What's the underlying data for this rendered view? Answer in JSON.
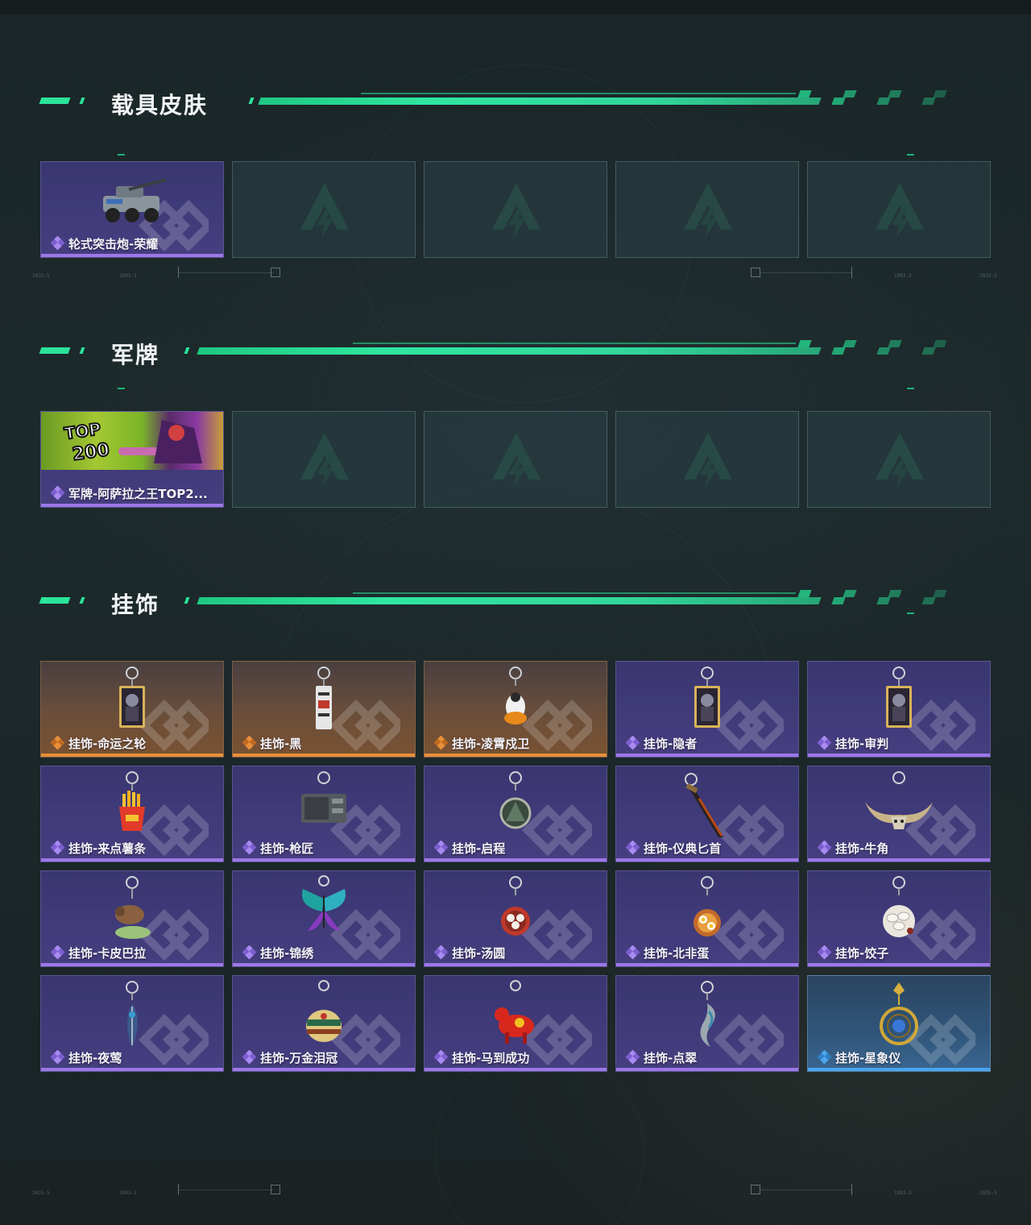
{
  "colors": {
    "accent": "#2be39a",
    "rarity_purple": "#9c78e8",
    "rarity_gold": "#e88f3a",
    "rarity_blue": "#4aa6ee"
  },
  "sections": [
    {
      "title": "载具皮肤",
      "items": [
        {
          "name": "轮式突击炮-荣耀",
          "rarity": "purple",
          "icon": "armored-vehicle-icon"
        },
        {
          "empty": true
        },
        {
          "empty": true
        },
        {
          "empty": true
        },
        {
          "empty": true
        }
      ]
    },
    {
      "title": "军牌",
      "items": [
        {
          "name": "军牌-阿萨拉之王TOP2...",
          "rarity": "purple",
          "icon": "top200-banner-icon"
        },
        {
          "empty": true
        },
        {
          "empty": true
        },
        {
          "empty": true
        },
        {
          "empty": true
        }
      ]
    },
    {
      "title": "挂饰",
      "items": [
        {
          "name": "挂饰-命运之轮",
          "rarity": "gold",
          "icon": "tarot-card-charm-icon"
        },
        {
          "name": "挂饰-黑",
          "rarity": "gold",
          "icon": "tag-charm-icon"
        },
        {
          "name": "挂饰-凌霄戍卫",
          "rarity": "gold",
          "icon": "bird-figure-charm-icon"
        },
        {
          "name": "挂饰-隐者",
          "rarity": "purple",
          "icon": "tarot-card-charm-icon"
        },
        {
          "name": "挂饰-审判",
          "rarity": "purple",
          "icon": "tarot-card-charm-icon"
        },
        {
          "name": "挂饰-来点薯条",
          "rarity": "purple",
          "icon": "fries-charm-icon"
        },
        {
          "name": "挂饰-枪匠",
          "rarity": "purple",
          "icon": "gun-part-charm-icon"
        },
        {
          "name": "挂饰-启程",
          "rarity": "purple",
          "icon": "medallion-charm-icon"
        },
        {
          "name": "挂饰-仪典匕首",
          "rarity": "purple",
          "icon": "dagger-charm-icon"
        },
        {
          "name": "挂饰-牛角",
          "rarity": "purple",
          "icon": "bull-horn-charm-icon"
        },
        {
          "name": "挂饰-卡皮巴拉",
          "rarity": "purple",
          "icon": "capybara-charm-icon"
        },
        {
          "name": "挂饰-锦绣",
          "rarity": "purple",
          "icon": "butterfly-charm-icon"
        },
        {
          "name": "挂饰-汤圆",
          "rarity": "purple",
          "icon": "bowl-charm-icon"
        },
        {
          "name": "挂饰-北非蛋",
          "rarity": "purple",
          "icon": "egg-dish-charm-icon"
        },
        {
          "name": "挂饰-饺子",
          "rarity": "purple",
          "icon": "dumpling-plate-charm-icon"
        },
        {
          "name": "挂饰-夜莺",
          "rarity": "purple",
          "icon": "feather-charm-icon"
        },
        {
          "name": "挂饰-万金泪冠",
          "rarity": "purple",
          "icon": "crown-charm-icon"
        },
        {
          "name": "挂饰-马到成功",
          "rarity": "purple",
          "icon": "horse-charm-icon"
        },
        {
          "name": "挂饰-点翠",
          "rarity": "purple",
          "icon": "phoenix-charm-icon"
        },
        {
          "name": "挂饰-星象仪",
          "rarity": "blue",
          "icon": "astrolabe-charm-icon"
        }
      ]
    }
  ]
}
